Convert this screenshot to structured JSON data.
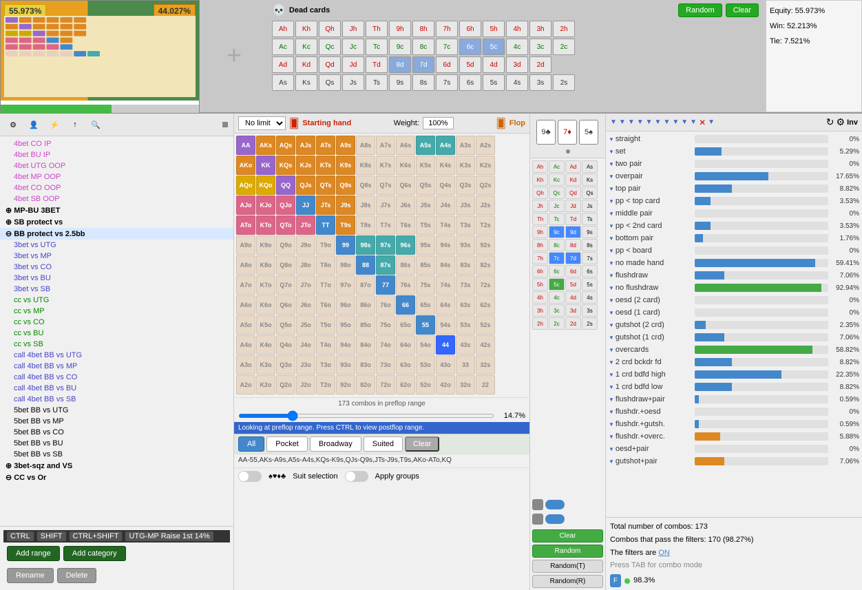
{
  "top": {
    "equity_left_pct": "55.973%",
    "equity_right_pct": "44.027%",
    "dead_cards_title": "Dead cards",
    "btn_random": "Random",
    "btn_clear": "Clear",
    "equity_label": "Equity: 55.973%",
    "win_label": "Win: 52.213%",
    "tie_label": "Tie: 7.521%",
    "card_rows": [
      [
        "Ah",
        "Kh",
        "Qh",
        "Jh",
        "Th",
        "9h",
        "8h",
        "7h",
        "6h",
        "5h",
        "4h",
        "3h",
        "2h"
      ],
      [
        "Ac",
        "Kc",
        "Qc",
        "Jc",
        "Tc",
        "9c",
        "8c",
        "7c",
        "6c",
        "5c",
        "4c",
        "3c",
        "2c"
      ],
      [
        "Ad",
        "Kd",
        "Qd",
        "Jd",
        "Td",
        "8d",
        "7d",
        "6d",
        "5d",
        "4d",
        "3d",
        "2d"
      ],
      [
        "As",
        "Ks",
        "Qs",
        "Js",
        "Ts",
        "9s",
        "8s",
        "7s",
        "6s",
        "5s",
        "4s",
        "3s",
        "2s"
      ]
    ]
  },
  "sidebar": {
    "items": [
      {
        "label": "4bet CO IP",
        "color": "pink",
        "level": 1
      },
      {
        "label": "4bet BU IP",
        "color": "pink",
        "level": 1
      },
      {
        "label": "4bet UTG OOP",
        "color": "pink",
        "level": 1
      },
      {
        "label": "4bet MP OOP",
        "color": "pink",
        "level": 1
      },
      {
        "label": "4bet CO OOP",
        "color": "pink",
        "level": 1
      },
      {
        "label": "4bet SB OOP",
        "color": "pink",
        "level": 1
      },
      {
        "label": "MP-BU 3BET",
        "color": "bold",
        "level": 0,
        "expandable": true
      },
      {
        "label": "SB protect vs",
        "color": "bold",
        "level": 0,
        "expandable": true
      },
      {
        "label": "BB protect vs 2.5bb",
        "color": "bold",
        "level": 0,
        "expanded": true
      },
      {
        "label": "3bet vs UTG",
        "color": "blue",
        "level": 1
      },
      {
        "label": "3bet vs MP",
        "color": "blue",
        "level": 1
      },
      {
        "label": "3bet vs CO",
        "color": "blue",
        "level": 1
      },
      {
        "label": "3bet vs BU",
        "color": "blue",
        "level": 1
      },
      {
        "label": "3bet vs SB",
        "color": "blue",
        "level": 1
      },
      {
        "label": "cc vs UTG",
        "color": "green",
        "level": 1
      },
      {
        "label": "cc vs MP",
        "color": "green",
        "level": 1
      },
      {
        "label": "cc vs CO",
        "color": "green",
        "level": 1
      },
      {
        "label": "cc vs BU",
        "color": "green",
        "level": 1
      },
      {
        "label": "cc vs SB",
        "color": "green",
        "level": 1
      },
      {
        "label": "call 4bet BB vs UTG",
        "color": "blue",
        "level": 1
      },
      {
        "label": "call 4bet BB vs MP",
        "color": "blue",
        "level": 1
      },
      {
        "label": "call 4bet BB vs CO",
        "color": "blue",
        "level": 1
      },
      {
        "label": "call 4bet BB vs BU",
        "color": "blue",
        "level": 1
      },
      {
        "label": "call 4bet BB vs SB",
        "color": "blue",
        "level": 1
      },
      {
        "label": "5bet BB vs UTG",
        "color": "normal",
        "level": 1
      },
      {
        "label": "5bet BB vs MP",
        "color": "normal",
        "level": 1
      },
      {
        "label": "5bet BB vs CO",
        "color": "normal",
        "level": 1
      },
      {
        "label": "5bet BB vs BU",
        "color": "normal",
        "level": 1
      },
      {
        "label": "5bet BB vs SB",
        "color": "normal",
        "level": 1
      },
      {
        "label": "3bet-sqz and VS",
        "color": "bold",
        "level": 0,
        "expandable": true
      },
      {
        "label": "CC vs Or",
        "color": "bold",
        "level": 0,
        "expandable": true
      }
    ],
    "breadcrumb": [
      "CTRL",
      "SHIFT",
      "CTRL+SHIFT",
      "UTG-MP Raise 1st 14%"
    ],
    "btn_add_range": "Add range",
    "btn_add_category": "Add category",
    "btn_rename": "Rename",
    "btn_delete": "Delete"
  },
  "range": {
    "dropdown": "No limit",
    "starting_hand_label": "Starting hand",
    "weight_label": "Weight:",
    "weight_value": "100%",
    "flop_label": "Flop",
    "info_text": "173 combos in preflop range",
    "range_pct": "14.7%",
    "range_text": "AA-55,AKs-A9s,A5s-A4s,KQs-K9s,QJs-Q9s,JTs-J9s,T9s,AKo-ATo,KQ",
    "filter_buttons": [
      "All",
      "Pocket",
      "Broadway",
      "Suited",
      "Clear"
    ],
    "suit_label": "Suit selection",
    "apply_label": "Apply groups",
    "preflop_notice": "Looking at preflop range. Press CTRL to view postflop range.",
    "cells": [
      [
        "AA",
        "AKs",
        "AQs",
        "AJs",
        "ATs",
        "A9s",
        "A8s",
        "A7s",
        "A6s",
        "A5s",
        "A4s",
        "A3s",
        "A2s"
      ],
      [
        "AKo",
        "KK",
        "KQs",
        "KJs",
        "KTs",
        "K9s",
        "K8s",
        "K7s",
        "K6s",
        "K5s",
        "K4s",
        "K3s",
        "K2s"
      ],
      [
        "AQo",
        "KQo",
        "QQ",
        "QJs",
        "QTs",
        "Q9s",
        "Q8s",
        "Q7s",
        "Q6s",
        "Q5s",
        "Q4s",
        "Q3s",
        "Q2s"
      ],
      [
        "AJo",
        "KJo",
        "QJo",
        "JJ",
        "JTs",
        "J9s",
        "J8s",
        "J7s",
        "J6s",
        "J5s",
        "J4s",
        "J3s",
        "J2s"
      ],
      [
        "ATo",
        "KTo",
        "QTo",
        "JTo",
        "TT",
        "T9s",
        "T8s",
        "T7s",
        "T6s",
        "T5s",
        "T4s",
        "T3s",
        "T2s"
      ],
      [
        "A9o",
        "K9o",
        "Q9o",
        "J9o",
        "T9o",
        "99",
        "98s",
        "97s",
        "96s",
        "95s",
        "94s",
        "93s",
        "92s"
      ],
      [
        "A8o",
        "K8o",
        "Q8o",
        "J8o",
        "T8o",
        "98o",
        "88",
        "87s",
        "86s",
        "85s",
        "84s",
        "83s",
        "82s"
      ],
      [
        "A7o",
        "K7o",
        "Q7o",
        "J7o",
        "T7o",
        "97o",
        "87o",
        "77",
        "76s",
        "75s",
        "74s",
        "73s",
        "72s"
      ],
      [
        "A6o",
        "K6o",
        "Q6o",
        "J6o",
        "T6o",
        "96o",
        "86o",
        "76o",
        "66",
        "65s",
        "64s",
        "63s",
        "62s"
      ],
      [
        "A5o",
        "K5o",
        "Q5o",
        "J5o",
        "T5o",
        "95o",
        "85o",
        "75o",
        "65o",
        "55",
        "54s",
        "53s",
        "52s"
      ],
      [
        "A4o",
        "K4o",
        "Q4o",
        "J4o",
        "T4o",
        "94o",
        "84o",
        "74o",
        "64o",
        "54o",
        "44",
        "43s",
        "42s"
      ],
      [
        "A3o",
        "K3o",
        "Q3o",
        "J3o",
        "T3o",
        "93o",
        "83o",
        "73o",
        "63o",
        "53o",
        "43o",
        "33",
        "32s"
      ],
      [
        "A2o",
        "K2o",
        "Q2o",
        "J2o",
        "T2o",
        "92o",
        "82o",
        "72o",
        "62o",
        "52o",
        "42o",
        "32o",
        "22"
      ]
    ],
    "cell_colors": {
      "AA": "purple",
      "AKs": "orange",
      "AQs": "orange",
      "AJs": "orange",
      "ATs": "orange",
      "A9s": "orange",
      "A5s": "teal",
      "A4s": "teal",
      "AKo": "orange",
      "KK": "purple",
      "KQs": "orange",
      "KJs": "orange",
      "KTs": "orange",
      "K9s": "orange",
      "AQo": "gold",
      "KQo": "gold",
      "QQ": "purple",
      "QJs": "orange",
      "QTs": "orange",
      "Q9s": "orange",
      "AJo": "pink",
      "KJo": "pink",
      "QJo": "pink",
      "JJ": "blue",
      "JTs": "orange",
      "J9s": "orange",
      "ATo": "pink",
      "KTo": "pink",
      "QTo": "pink",
      "JTo": "pink",
      "TT": "blue",
      "T9s": "orange",
      "99": "blue",
      "98s": "teal",
      "97s": "teal",
      "96s": "teal",
      "88": "blue",
      "87s": "teal",
      "77": "blue",
      "66": "blue",
      "55": "blue",
      "44": "selected"
    }
  },
  "flop": {
    "board_cards": [
      "9♣",
      "7♦",
      "5♠"
    ],
    "btn_clear": "Clear",
    "btn_random": "Random",
    "btn_random_t": "Random(T)",
    "btn_random_r": "Random(R)"
  },
  "stats": {
    "title_filters": "▼▼▼▼▼▼▼▼▼▼▼✕▼",
    "btn_refresh": "↻",
    "btn_inv": "Inv",
    "rows": [
      {
        "name": "straight",
        "pct": "0%",
        "bar_pct": 0,
        "color": "blue"
      },
      {
        "name": "set",
        "pct": "5.29%",
        "bar_pct": 20,
        "color": "blue"
      },
      {
        "name": "two pair",
        "pct": "0%",
        "bar_pct": 0,
        "color": "blue"
      },
      {
        "name": "overpair",
        "pct": "17.65%",
        "bar_pct": 55,
        "color": "blue"
      },
      {
        "name": "top pair",
        "pct": "8.82%",
        "bar_pct": 28,
        "color": "blue"
      },
      {
        "name": "pp < top card",
        "pct": "3.53%",
        "bar_pct": 12,
        "color": "blue"
      },
      {
        "name": "middle pair",
        "pct": "0%",
        "bar_pct": 0,
        "color": "blue"
      },
      {
        "name": "pp < 2nd card",
        "pct": "3.53%",
        "bar_pct": 12,
        "color": "blue"
      },
      {
        "name": "bottom pair",
        "pct": "1.76%",
        "bar_pct": 6,
        "color": "blue"
      },
      {
        "name": "pp < board",
        "pct": "0%",
        "bar_pct": 0,
        "color": "blue"
      },
      {
        "name": "no made hand",
        "pct": "59.41%",
        "bar_pct": 90,
        "color": "blue"
      },
      {
        "name": "flushdraw",
        "pct": "7.06%",
        "bar_pct": 22,
        "color": "blue"
      },
      {
        "name": "no flushdraw",
        "pct": "92.94%",
        "bar_pct": 95,
        "color": "green"
      },
      {
        "name": "oesd (2 card)",
        "pct": "0%",
        "bar_pct": 0,
        "color": "blue"
      },
      {
        "name": "oesd (1 card)",
        "pct": "0%",
        "bar_pct": 0,
        "color": "blue"
      },
      {
        "name": "gutshot (2 crd)",
        "pct": "2.35%",
        "bar_pct": 8,
        "color": "blue"
      },
      {
        "name": "gutshot (1 crd)",
        "pct": "7.06%",
        "bar_pct": 22,
        "color": "blue"
      },
      {
        "name": "overcards",
        "pct": "58.82%",
        "bar_pct": 88,
        "color": "green"
      },
      {
        "name": "2 crd bckdr fd",
        "pct": "8.82%",
        "bar_pct": 28,
        "color": "blue"
      },
      {
        "name": "1 crd bdfd high",
        "pct": "22.35%",
        "bar_pct": 65,
        "color": "blue"
      },
      {
        "name": "1 crd bdfd low",
        "pct": "8.82%",
        "bar_pct": 28,
        "color": "blue"
      },
      {
        "name": "flushdraw+pair",
        "pct": "0.59%",
        "bar_pct": 3,
        "color": "blue"
      },
      {
        "name": "flushdr.+oesd",
        "pct": "0%",
        "bar_pct": 0,
        "color": "blue"
      },
      {
        "name": "flushdr.+gutsh.",
        "pct": "0.59%",
        "bar_pct": 3,
        "color": "blue"
      },
      {
        "name": "flushdr.+overc.",
        "pct": "5.88%",
        "bar_pct": 19,
        "color": "orange"
      },
      {
        "name": "oesd+pair",
        "pct": "0%",
        "bar_pct": 0,
        "color": "blue"
      },
      {
        "name": "gutshot+pair",
        "pct": "7.06%",
        "bar_pct": 22,
        "color": "orange"
      }
    ],
    "total_combos": "Total number of combos: 173",
    "combos_pass": "Combos that pass the filters: 170 (98.27%)",
    "filters_on": "The filters are ON",
    "tab_hint": "Press TAB for combo mode",
    "f_badge": "F",
    "f_pct": "98.3%"
  }
}
